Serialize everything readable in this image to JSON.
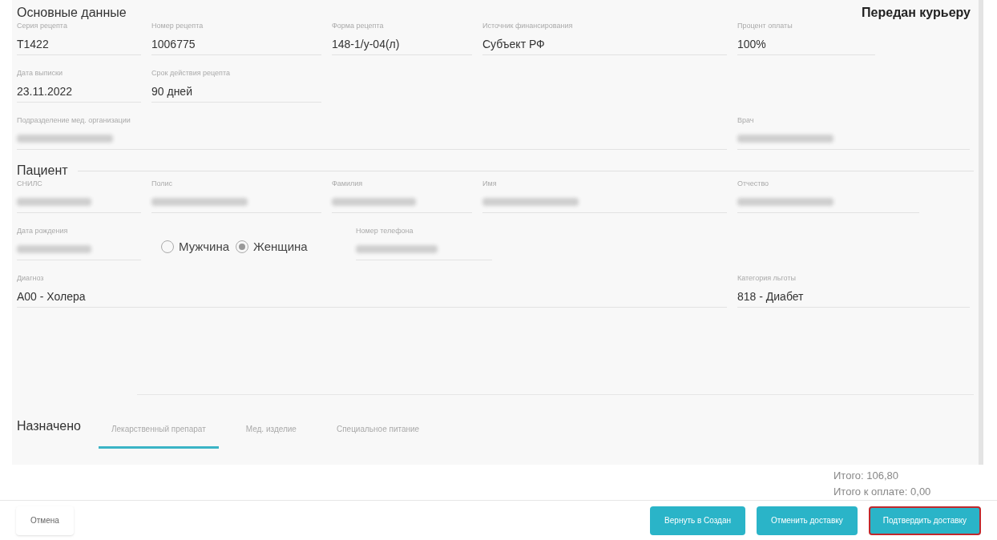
{
  "status": "Передан курьеру",
  "sections": [
    {
      "title": "Основные данные",
      "rows": [
        [
          {
            "kind": "text",
            "label": "Серия рецепта",
            "value": "T1422"
          },
          {
            "kind": "text",
            "label": "Номер рецепта",
            "value": "1006775"
          },
          {
            "kind": "text",
            "label": "Форма рецепта",
            "value": "148-1/у-04(л)"
          },
          {
            "kind": "text",
            "label": "Источник финансирования",
            "value": "Субъект РФ"
          },
          {
            "kind": "text",
            "label": "Процент оплаты",
            "value": "100%"
          }
        ],
        [
          {
            "kind": "text",
            "label": "Дата выписки",
            "value": "23.11.2022"
          },
          {
            "kind": "text",
            "label": "Срок действия рецепта",
            "value": "90 дней"
          }
        ],
        [
          {
            "kind": "redacted",
            "label": "Подразделение мед. организации"
          },
          "",
          "",
          "",
          {
            "kind": "redacted",
            "label": "Врач"
          }
        ]
      ]
    },
    {
      "title": "Пациент",
      "rows": [
        [
          {
            "kind": "redacted",
            "label": "СНИЛС"
          },
          {
            "kind": "redacted",
            "label": "Полис"
          },
          {
            "kind": "redacted",
            "label": "Фамилия"
          },
          {
            "kind": "redacted",
            "label": "Имя"
          },
          {
            "kind": "redacted",
            "label": "Отчество"
          }
        ],
        [
          {
            "kind": "redacted",
            "label": "Дата рождения"
          },
          {
            "kind": "radio",
            "options": [
              {
                "label": "Мужчина",
                "selected": false
              },
              {
                "label": "Женщина",
                "selected": true
              }
            ]
          },
          {
            "kind": "redacted",
            "label": "Номер телефона"
          }
        ],
        [
          {
            "kind": "text",
            "label": "Диагноз",
            "value": "A00 - Холера"
          },
          "",
          "",
          "",
          {
            "kind": "text",
            "label": "Категория льготы",
            "value": "818 - Диабет"
          }
        ]
      ]
    }
  ],
  "prescribed": {
    "title": "Назначено",
    "tabs": [
      {
        "label": "Лекарственный препарат",
        "selected": true
      },
      {
        "label": "Мед. изделие",
        "selected": false
      },
      {
        "label": "Специальное питание",
        "selected": false
      }
    ]
  },
  "totals": [
    "Итого: 106,80",
    "Итого к оплате: 0,00"
  ],
  "buttons": [
    {
      "label": "Отмена",
      "kind": "secondary",
      "highlighted": false
    },
    {
      "label": "Вернуть в Создан",
      "kind": "primary",
      "highlighted": false
    },
    {
      "label": "Отменить доставку",
      "kind": "primary",
      "highlighted": false
    },
    {
      "label": "Подтвердить доставку",
      "kind": "primary",
      "highlighted": true
    }
  ]
}
